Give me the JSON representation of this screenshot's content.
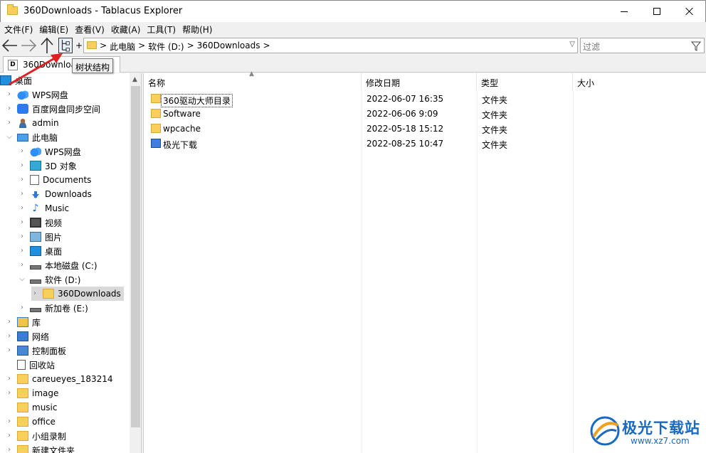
{
  "window": {
    "title": "360Downloads - Tablacus Explorer"
  },
  "menu": [
    "文件(F)",
    "编辑(E)",
    "查看(V)",
    "收藏(A)",
    "工具(T)",
    "帮助(H)"
  ],
  "toolbar": {
    "plus": "+",
    "breadcrumbs": [
      ">",
      "此电脑",
      ">",
      "软件 (D:)",
      ">",
      "360Downloads",
      ">"
    ],
    "filter_placeholder": "过滤",
    "tooltip": "树状结构"
  },
  "tab": {
    "icon_letter": "D",
    "label": "360Downloads"
  },
  "tree": [
    {
      "label": "桌面",
      "icon": "desk",
      "level": 0,
      "chevron": "",
      "selected": false
    },
    {
      "label": "WPS网盘",
      "icon": "cloud",
      "level": 1,
      "chevron": "›"
    },
    {
      "label": "百度网盘同步空间",
      "icon": "baidu",
      "level": 1,
      "chevron": "›"
    },
    {
      "label": "admin",
      "icon": "user",
      "level": 1,
      "chevron": "›"
    },
    {
      "label": "此电脑",
      "icon": "pc",
      "level": 1,
      "chevron": "⌄"
    },
    {
      "label": "WPS网盘",
      "icon": "cloud",
      "level": 2,
      "chevron": "›"
    },
    {
      "label": "3D 对象",
      "icon": "cube",
      "level": 2,
      "chevron": "›"
    },
    {
      "label": "Documents",
      "icon": "doc",
      "level": 2,
      "chevron": "›"
    },
    {
      "label": "Downloads",
      "icon": "down",
      "level": 2,
      "chevron": "›"
    },
    {
      "label": "Music",
      "icon": "music",
      "level": 2,
      "chevron": "›"
    },
    {
      "label": "视频",
      "icon": "video",
      "level": 2,
      "chevron": "›"
    },
    {
      "label": "图片",
      "icon": "pic",
      "level": 2,
      "chevron": "›"
    },
    {
      "label": "桌面",
      "icon": "desk",
      "level": 2,
      "chevron": "›"
    },
    {
      "label": "本地磁盘 (C:)",
      "icon": "drive",
      "level": 2,
      "chevron": "›"
    },
    {
      "label": "软件 (D:)",
      "icon": "drive",
      "level": 2,
      "chevron": "⌄"
    },
    {
      "label": "360Downloads",
      "icon": "folder",
      "level": 3,
      "chevron": "›",
      "selected": true
    },
    {
      "label": "新加卷 (E:)",
      "icon": "drive",
      "level": 2,
      "chevron": "›"
    },
    {
      "label": "库",
      "icon": "lib",
      "level": 1,
      "chevron": "›"
    },
    {
      "label": "网络",
      "icon": "net",
      "level": 1,
      "chevron": "›"
    },
    {
      "label": "控制面板",
      "icon": "cp",
      "level": 1,
      "chevron": "›"
    },
    {
      "label": "回收站",
      "icon": "bin",
      "level": 1,
      "chevron": ""
    },
    {
      "label": "careueyes_183214",
      "icon": "folder",
      "level": 1,
      "chevron": "›"
    },
    {
      "label": "image",
      "icon": "folder",
      "level": 1,
      "chevron": "›"
    },
    {
      "label": "music",
      "icon": "folder",
      "level": 1,
      "chevron": ""
    },
    {
      "label": "office",
      "icon": "folder",
      "level": 1,
      "chevron": "›"
    },
    {
      "label": "小组录制",
      "icon": "folder",
      "level": 1,
      "chevron": "›"
    },
    {
      "label": "新建文件夹",
      "icon": "folder",
      "level": 1,
      "chevron": "›"
    }
  ],
  "files": {
    "columns": [
      "名称",
      "修改日期",
      "类型",
      "大小"
    ],
    "rows": [
      {
        "name": "360驱动大师目录",
        "date": "2022-06-07 16:35",
        "type": "文件夹",
        "size": "",
        "icon": "folder",
        "focused": true
      },
      {
        "name": "Software",
        "date": "2022-06-06 9:09",
        "type": "文件夹",
        "size": "",
        "icon": "folder"
      },
      {
        "name": "wpcache",
        "date": "2022-05-18 15:12",
        "type": "文件夹",
        "size": "",
        "icon": "folder"
      },
      {
        "name": "极光下载",
        "date": "2022-08-25 10:47",
        "type": "文件夹",
        "size": "",
        "icon": "special"
      }
    ]
  },
  "watermark": {
    "title": "极光下载站",
    "url": "www.xz7.com"
  },
  "colors": {
    "accent": "#1769c2",
    "annotation": "#e02020",
    "folder": "#f7cf5a"
  }
}
